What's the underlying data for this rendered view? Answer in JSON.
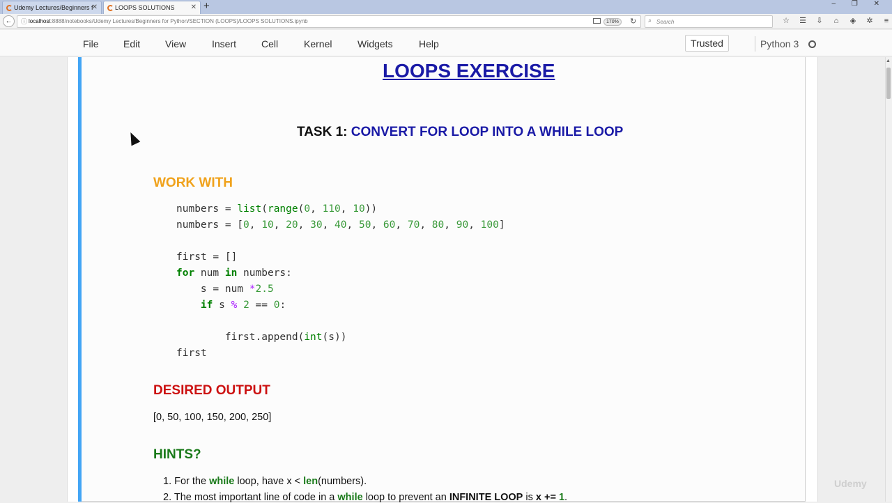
{
  "browser": {
    "tabs": [
      {
        "label": "Udemy Lectures/Beginners f"
      },
      {
        "label": "LOOPS SOLUTIONS"
      }
    ],
    "url_host": "localhost",
    "url_path": ":8888/notebooks/Udemy Lectures/Beginners for Python/SECTION  (LOOPS)/LOOPS SOLUTIONS.ipynb",
    "zoom": "170%",
    "search_placeholder": "Search"
  },
  "menu": {
    "items": [
      "File",
      "Edit",
      "View",
      "Insert",
      "Cell",
      "Kernel",
      "Widgets",
      "Help"
    ],
    "trusted": "Trusted",
    "kernel": "Python 3"
  },
  "notebook": {
    "title": "LOOPS EXERCISE",
    "task_prefix": "TASK 1: ",
    "task_desc": "CONVERT FOR LOOP INTO A WHILE LOOP",
    "work_heading": "WORK WITH",
    "desired_heading": "DESIRED OUTPUT",
    "desired_output": "[0, 50, 100, 150, 200, 250]",
    "hints_heading": "HINTS?",
    "code": {
      "l1": "numbers = list(range(0, 110, 10))",
      "l2": "numbers = [0, 10, 20, 30, 40, 50, 60, 70, 80, 90, 100]",
      "l3": "first = []",
      "l4": "for num in numbers:",
      "l5": "    s = num *2.5",
      "l6": "    if s % 2 == 0:",
      "l7": "        first.append(int(s))",
      "l8": "first"
    },
    "hints": {
      "h1": {
        "a": "1. For the ",
        "b": "while",
        "c": " loop, have x < ",
        "d": "len",
        "e": "(numbers)."
      },
      "h2": {
        "a": "2. The most important line of code in a ",
        "b": "while",
        "c": " loop to prevent an ",
        "d": "INFINITE LOOP",
        "e": " is ",
        "f": "x += ",
        "g": "1",
        "h": "."
      }
    }
  },
  "watermark": "Udemy"
}
